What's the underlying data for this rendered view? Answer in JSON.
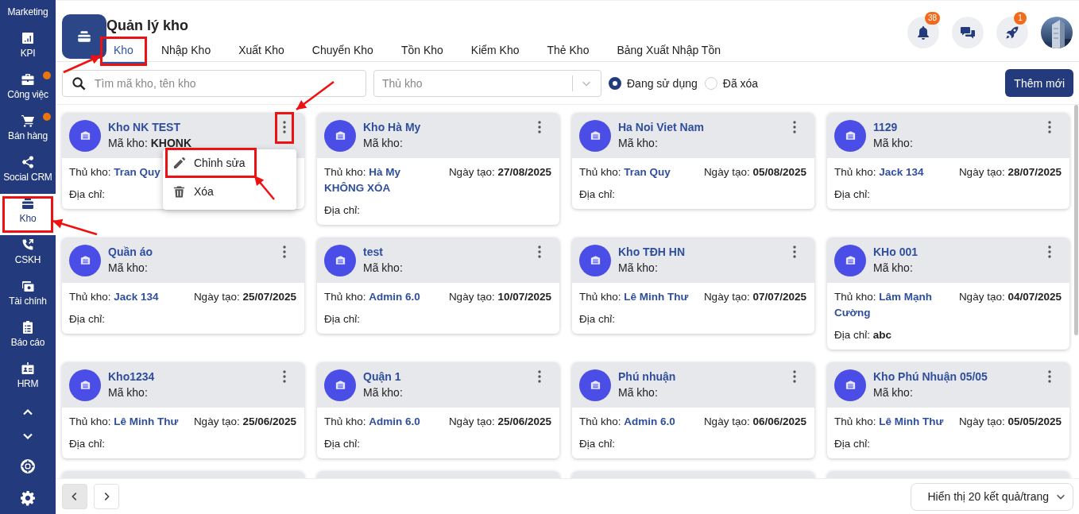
{
  "sidebar": {
    "items": [
      {
        "label": "Marketing",
        "selected": false,
        "dot": false,
        "highlighted": false
      },
      {
        "label": "KPI",
        "selected": false,
        "dot": false,
        "highlighted": false
      },
      {
        "label": "Công việc",
        "selected": false,
        "dot": true,
        "highlighted": false
      },
      {
        "label": "Bán hàng",
        "selected": false,
        "dot": true,
        "highlighted": false
      },
      {
        "label": "Social CRM",
        "selected": false,
        "dot": false,
        "highlighted": false
      },
      {
        "label": "Kho",
        "selected": true,
        "dot": false,
        "highlighted": true
      },
      {
        "label": "CSKH",
        "selected": false,
        "dot": false,
        "highlighted": false
      },
      {
        "label": "Tài chính",
        "selected": false,
        "dot": false,
        "highlighted": false
      },
      {
        "label": "Báo cáo",
        "selected": false,
        "dot": false,
        "highlighted": false
      },
      {
        "label": "HRM",
        "selected": false,
        "dot": false,
        "highlighted": false
      }
    ]
  },
  "header": {
    "title": "Quản lý kho",
    "tabs": [
      {
        "label": "Kho",
        "selected": true,
        "highlighted": true
      },
      {
        "label": "Nhập Kho",
        "selected": false,
        "highlighted": false
      },
      {
        "label": "Xuất Kho",
        "selected": false,
        "highlighted": false
      },
      {
        "label": "Chuyển Kho",
        "selected": false,
        "highlighted": false
      },
      {
        "label": "Tồn Kho",
        "selected": false,
        "highlighted": false
      },
      {
        "label": "Kiểm Kho",
        "selected": false,
        "highlighted": false
      },
      {
        "label": "Thẻ Kho",
        "selected": false,
        "highlighted": false
      },
      {
        "label": "Bảng Xuất Nhập Tồn",
        "selected": false,
        "highlighted": false
      }
    ],
    "notifications_badge": "38",
    "rocket_badge": "1"
  },
  "filters": {
    "search": {
      "placeholder": "Tìm mã kho, tên kho"
    },
    "keeper_select": {
      "placeholder": "Thủ kho"
    },
    "status": [
      {
        "label": "Đang sử dụng",
        "selected": true
      },
      {
        "label": "Đã xóa",
        "selected": false
      }
    ],
    "add_button": "Thêm mới"
  },
  "cards": [
    {
      "name": "Kho NK TEST",
      "code_label": "Mã kho:",
      "code": "KHONK",
      "keeper_label": "Thủ kho:",
      "keeper": "Tran Quy",
      "address_label": "Địa chỉ:",
      "menu_open": true
    },
    {
      "name": "Kho Hà My",
      "code_label": "Mã kho:",
      "keeper_label": "Thủ kho:",
      "keeper": "Hà My KHÔNG XÓA",
      "date_label": "Ngày tạo:",
      "date": "27/08/2025",
      "address_label": "Địa chỉ:",
      "menu_open": false
    },
    {
      "name": "Ha Noi Viet Nam",
      "code_label": "Mã kho:",
      "keeper_label": "Thủ kho:",
      "keeper": "Tran Quy",
      "date_label": "Ngày tạo:",
      "date": "05/08/2025",
      "address_label": "Địa chỉ:",
      "menu_open": false
    },
    {
      "name": "1129",
      "code_label": "Mã kho:",
      "keeper_label": "Thủ kho:",
      "keeper": "Jack 134",
      "date_label": "Ngày tạo:",
      "date": "28/07/2025",
      "address_label": "Địa chỉ:",
      "menu_open": false
    },
    {
      "name": "Quần áo",
      "code_label": "Mã kho:",
      "keeper_label": "Thủ kho:",
      "keeper": "Jack 134",
      "date_label": "Ngày tạo:",
      "date": "25/07/2025",
      "address_label": "Địa chỉ:",
      "menu_open": false
    },
    {
      "name": "test",
      "code_label": "Mã kho:",
      "keeper_label": "Thủ kho:",
      "keeper": "Admin 6.0",
      "date_label": "Ngày tạo:",
      "date": "10/07/2025",
      "address_label": "Địa chỉ:",
      "menu_open": false
    },
    {
      "name": "Kho TĐH HN",
      "code_label": "Mã kho:",
      "keeper_label": "Thủ kho:",
      "keeper": "Lê Minh Thư",
      "date_label": "Ngày tạo:",
      "date": "07/07/2025",
      "address_label": "Địa chỉ:",
      "menu_open": false
    },
    {
      "name": "KHo 001",
      "code_label": "Mã kho:",
      "keeper_label": "Thủ kho:",
      "keeper": "Lâm Mạnh Cường",
      "date_label": "Ngày tạo:",
      "date": "04/07/2025",
      "address_label": "Địa chỉ:",
      "address": "abc",
      "menu_open": false
    },
    {
      "name": "Kho1234",
      "code_label": "Mã kho:",
      "keeper_label": "Thủ kho:",
      "keeper": "Lê Minh Thư",
      "date_label": "Ngày tạo:",
      "date": "25/06/2025",
      "address_label": "Địa chỉ:",
      "menu_open": false
    },
    {
      "name": "Quận 1",
      "code_label": "Mã kho:",
      "keeper_label": "Thủ kho:",
      "keeper": "Admin 6.0",
      "date_label": "Ngày tạo:",
      "date": "25/06/2025",
      "address_label": "Địa chỉ:",
      "menu_open": false
    },
    {
      "name": "Phú nhuận",
      "code_label": "Mã kho:",
      "keeper_label": "Thủ kho:",
      "keeper": "Admin 6.0",
      "date_label": "Ngày tạo:",
      "date": "06/06/2025",
      "address_label": "Địa chỉ:",
      "menu_open": false
    },
    {
      "name": "Kho Phú Nhuận 05/05",
      "code_label": "Mã kho:",
      "keeper_label": "Thủ kho:",
      "keeper": "Lê Minh Thư",
      "date_label": "Ngày tạo:",
      "date": "05/05/2025",
      "address_label": "Địa chỉ:",
      "menu_open": false
    }
  ],
  "more_cards_below": true,
  "card_menu": {
    "items": [
      {
        "kind": "edit",
        "label": "Chỉnh sửa",
        "highlighted": true
      },
      {
        "kind": "delete",
        "label": "Xóa",
        "highlighted": false
      }
    ]
  },
  "pagination": {
    "page_size": "Hiển thị 20 kết quả/trang"
  }
}
